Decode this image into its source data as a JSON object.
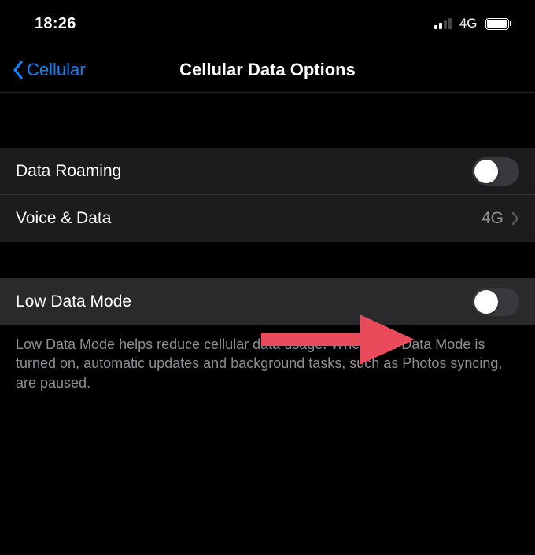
{
  "status": {
    "time": "18:26",
    "network_type": "4G",
    "signal_strength": 2
  },
  "nav": {
    "back_label": "Cellular",
    "title": "Cellular Data Options"
  },
  "group1": {
    "rows": [
      {
        "label": "Data Roaming",
        "type": "toggle",
        "on": false
      },
      {
        "label": "Voice & Data",
        "type": "disclosure",
        "value": "4G"
      }
    ]
  },
  "group2": {
    "rows": [
      {
        "label": "Low Data Mode",
        "type": "toggle",
        "on": false
      }
    ],
    "footer": "Low Data Mode helps reduce cellular data usage. When Low Data Mode is turned on, automatic updates and background tasks, such as Photos syncing, are paused."
  },
  "annotation": {
    "arrow_color": "#e94b5a"
  }
}
